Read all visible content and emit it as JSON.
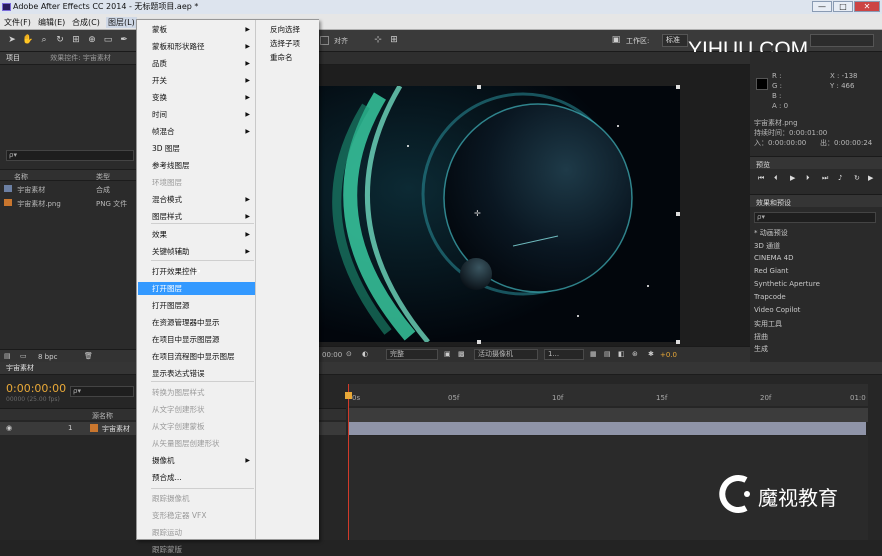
{
  "window": {
    "title": "Adobe After Effects CC 2014 - 无标题项目.aep *",
    "minimize": "—",
    "maximize": "□",
    "close": "✕"
  },
  "menubar": [
    "文件(F)",
    "编辑(E)",
    "合成(C)",
    "图层(L)"
  ],
  "toolbar": {
    "snap_label": "对齐",
    "workspace_label": "工作区:",
    "workspace_value": "标准",
    "search_placeholder": "搜索帮助"
  },
  "watermark": "YIHUU.COM",
  "project": {
    "tab": "项目",
    "effect_controls_tab": "效果控件: 宇宙素材",
    "search_placeholder": "ρ▾",
    "columns": {
      "name": "名称",
      "type": "类型"
    },
    "items": [
      {
        "name": "宇宙素材",
        "type": "合成"
      },
      {
        "name": "宇宙素材.png",
        "type": "PNG 文件"
      }
    ],
    "bpc": "8 bpc"
  },
  "comp_footer": {
    "zoom": "00:00",
    "quality": "完整",
    "camera": "活动摄像机",
    "views": "1...",
    "exposure": "+0.0"
  },
  "info": {
    "r": "R :",
    "g": "G :",
    "b": "B :",
    "a": "A : 0",
    "x": "X : -138",
    "y": "Y : 466",
    "file": "宇宙素材.png",
    "duration": "持续时间：0:00:01:00",
    "in": "入：0:00:00:00",
    "out": "出：0:00:00:24"
  },
  "preview_tab": "预览",
  "effects": {
    "tab": "效果和预设",
    "search_placeholder": "ρ▾",
    "items": [
      "* 动画预设",
      "3D 通道",
      "CINEMA 4D",
      "Red Giant",
      "Synthetic Aperture",
      "Trapcode",
      "Video Copilot",
      "实用工具",
      "扭曲",
      "生成"
    ]
  },
  "timeline": {
    "tab": "宇宙素材",
    "timecode": "0:00:00:00",
    "fps": "00000 (25.00 fps)",
    "search_placeholder": "ρ▾",
    "layer_col": "源名称",
    "layer_num": "1",
    "layer_name": "宇宙素材",
    "ruler": [
      "0s",
      "05f",
      "10f",
      "15f",
      "20f",
      "01:0"
    ]
  },
  "menu": {
    "items": [
      {
        "label": "蒙板",
        "sub": true,
        "disabled": false
      },
      {
        "label": "蒙板和形状路径",
        "sub": true,
        "disabled": false
      },
      {
        "label": "品质",
        "sub": true,
        "disabled": false
      },
      {
        "label": "开关",
        "sub": true,
        "disabled": false
      },
      {
        "label": "变换",
        "sub": true,
        "disabled": false
      },
      {
        "label": "时间",
        "sub": true,
        "disabled": false
      },
      {
        "label": "帧混合",
        "sub": true,
        "disabled": false
      },
      {
        "label": "3D 图层",
        "sub": false,
        "disabled": false
      },
      {
        "label": "参考线图层",
        "sub": false,
        "disabled": false
      },
      {
        "label": "环境图层",
        "sub": false,
        "disabled": true
      },
      {
        "label": "混合模式",
        "sub": true,
        "disabled": false
      },
      {
        "label": "图层样式",
        "sub": true,
        "disabled": false
      },
      {
        "label": "效果",
        "sub": true,
        "disabled": false
      },
      {
        "label": "关键帧辅助",
        "sub": true,
        "disabled": false
      },
      {
        "label": "打开效果控件",
        "sub": false,
        "disabled": false
      },
      {
        "label": "打开图层",
        "sub": false,
        "disabled": false,
        "highlight": true
      },
      {
        "label": "打开图层源",
        "sub": false,
        "disabled": false
      },
      {
        "label": "在资源管理器中显示",
        "sub": false,
        "disabled": false
      },
      {
        "label": "在项目中显示图层源",
        "sub": false,
        "disabled": false
      },
      {
        "label": "在项目流程图中显示图层",
        "sub": false,
        "disabled": false
      },
      {
        "label": "显示表达式错误",
        "sub": false,
        "disabled": false
      },
      {
        "label": "转换为图层样式",
        "sub": false,
        "disabled": true
      },
      {
        "label": "从文字创建形状",
        "sub": false,
        "disabled": true
      },
      {
        "label": "从文字创建蒙板",
        "sub": false,
        "disabled": true
      },
      {
        "label": "从矢量图层创建形状",
        "sub": false,
        "disabled": true
      },
      {
        "label": "摄像机",
        "sub": true,
        "disabled": false
      },
      {
        "label": "预合成...",
        "sub": false,
        "disabled": false
      },
      {
        "label": "跟踪摄像机",
        "sub": false,
        "disabled": true
      },
      {
        "label": "变形稳定器 VFX",
        "sub": false,
        "disabled": true
      },
      {
        "label": "跟踪运动",
        "sub": false,
        "disabled": true
      },
      {
        "label": "跟踪蒙版",
        "sub": false,
        "disabled": true
      }
    ],
    "submenu": [
      "反向选择",
      "选择子项",
      "重命名"
    ]
  },
  "brand": {
    "name": "魔视教育"
  },
  "colors": {
    "accent": "#3399ff",
    "timecode": "#e8a838",
    "work_area": "#8f94a8"
  }
}
